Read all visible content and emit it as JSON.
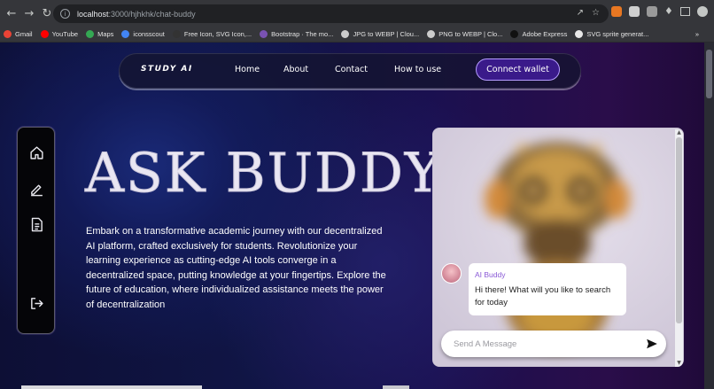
{
  "browser": {
    "url_host": "localhost",
    "url_rest": ":3000/hjhkhk/chat-buddy",
    "bookmarks": [
      {
        "label": "Gmail",
        "color": "#ea4335"
      },
      {
        "label": "YouTube",
        "color": "#ff0000"
      },
      {
        "label": "Maps",
        "color": "#34a853"
      },
      {
        "label": "iconsscout",
        "color": "#4285f4"
      },
      {
        "label": "Free Icon, SVG Icon,...",
        "color": "#333333"
      },
      {
        "label": "Bootstrap · The mo...",
        "color": "#7952b3"
      },
      {
        "label": "JPG to WEBP | Clou...",
        "color": "#cccccc"
      },
      {
        "label": "PNG to WEBP | Clo...",
        "color": "#cccccc"
      },
      {
        "label": "Adobe Express",
        "color": "#111111"
      },
      {
        "label": "SVG sprite generat...",
        "color": "#e8e8e8"
      }
    ],
    "more_bookmarks": "»"
  },
  "navbar": {
    "brand": "STUDY AI",
    "links": [
      "Home",
      "About",
      "Contact",
      "How to use"
    ],
    "cta": "Connect wallet"
  },
  "sidebar": {
    "icons": [
      "home-icon",
      "edit-icon",
      "document-icon",
      "logout-icon"
    ]
  },
  "hero": {
    "title": "ASK BUDDY",
    "description": "Embark on a transformative academic journey with our decentralized AI platform, crafted exclusively for students. Revolutionize your learning experience as cutting-edge AI tools converge in a decentralized space, putting knowledge at your fingertips. Explore the future of education, where individualized assistance meets the power of decentralization"
  },
  "chat": {
    "bot_name": "AI Buddy",
    "bot_message": "Hi there! What will you like to search for today",
    "input_placeholder": "Send A Message"
  },
  "colors": {
    "accent": "#8a5ad6",
    "cta_bg": "#3a1a8a"
  }
}
